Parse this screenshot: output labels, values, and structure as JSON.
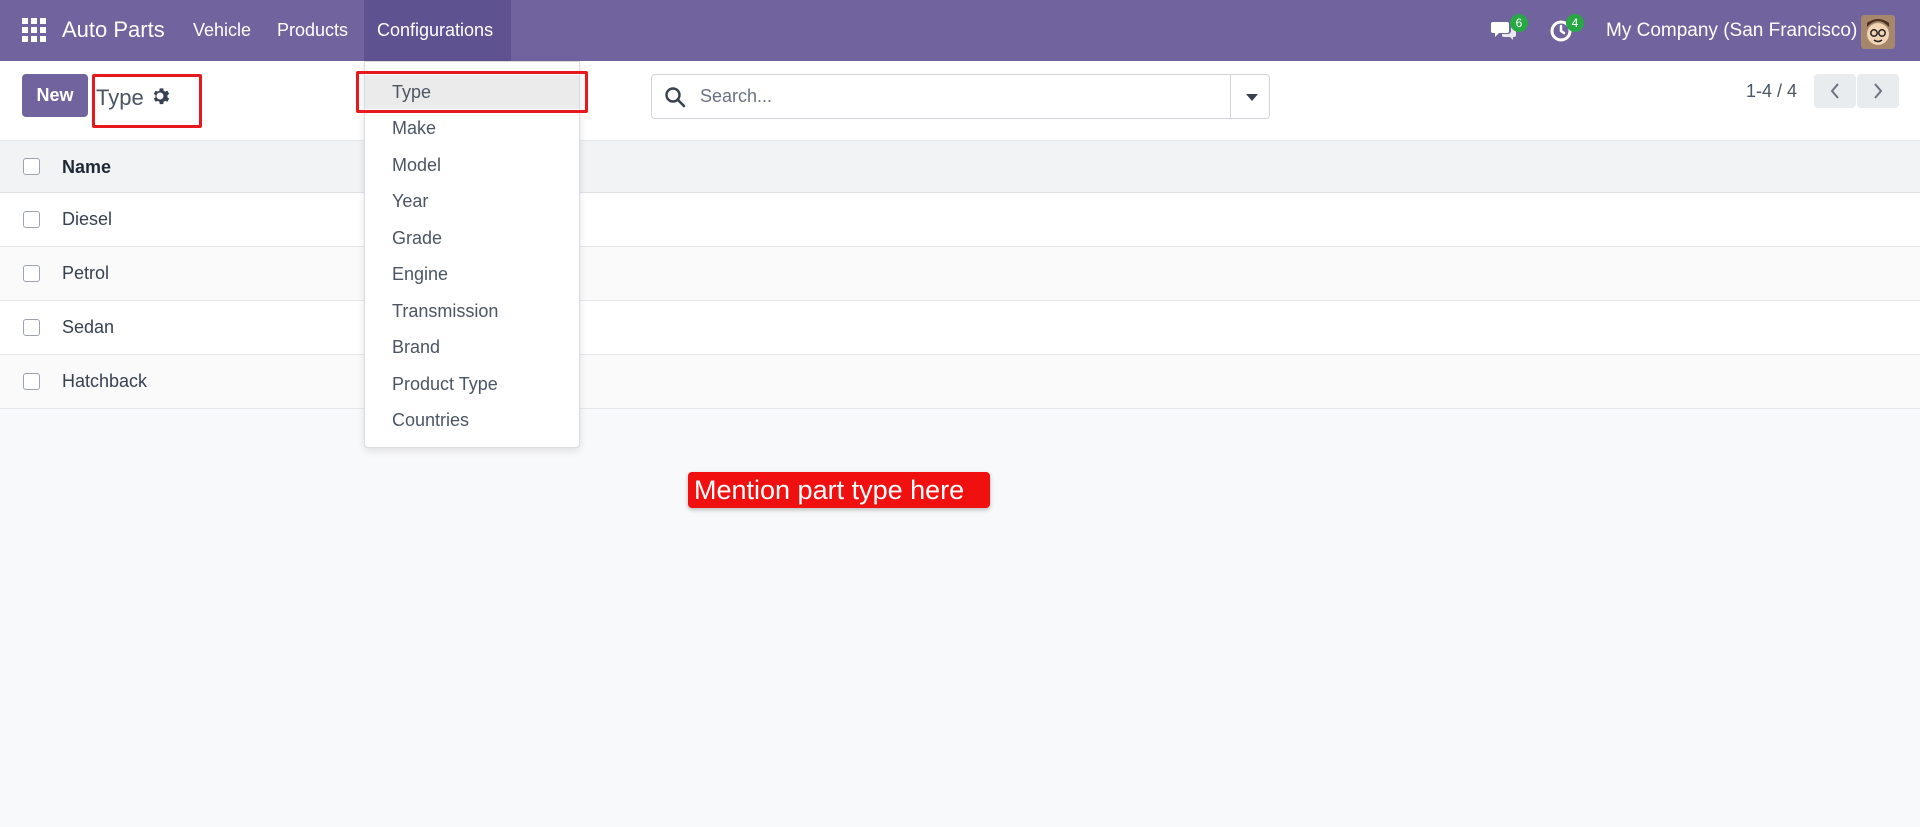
{
  "navbar": {
    "app_name": "Auto Parts",
    "menu": [
      "Vehicle",
      "Products",
      "Configurations"
    ],
    "chat_count": "6",
    "activity_count": "4",
    "company": "My Company (San Francisco)",
    "bg_color": "#71639e"
  },
  "control_panel": {
    "new_label": "New",
    "breadcrumb": "Type",
    "search_placeholder": "Search...",
    "pager": "1-4 / 4"
  },
  "list": {
    "column_name": "Name",
    "rows": [
      "Diesel",
      "Petrol",
      "Sedan",
      "Hatchback"
    ]
  },
  "dropdown": {
    "items": [
      "Type",
      "Make",
      "Model",
      "Year",
      "Grade",
      "Engine",
      "Transmission",
      "Brand",
      "Product Type",
      "Countries"
    ],
    "active": "Type"
  },
  "annotation": {
    "text": "Mention part type here",
    "color": "#f01010"
  }
}
